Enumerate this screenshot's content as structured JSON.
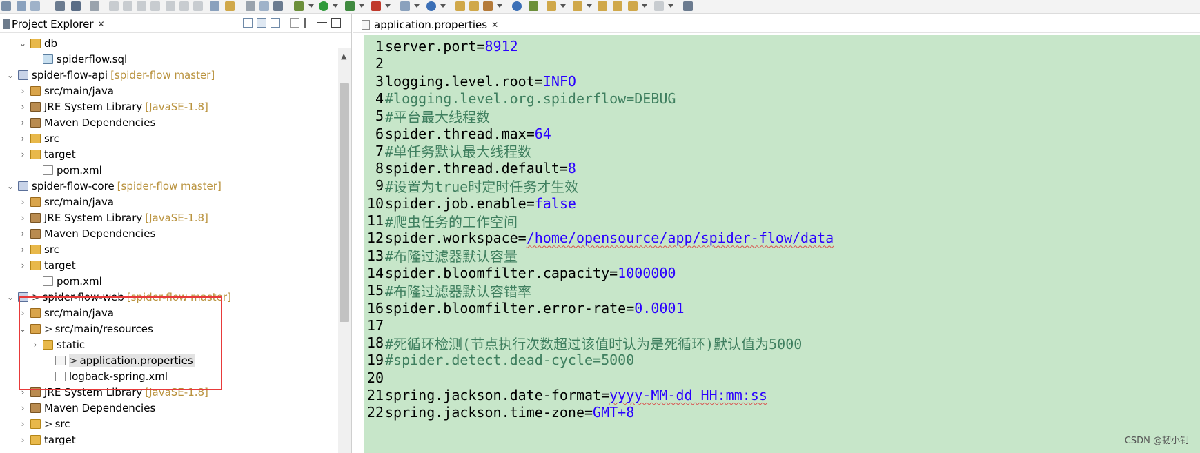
{
  "project_explorer": {
    "title": "Project Explorer",
    "close_icon": "close-icon",
    "tree": [
      {
        "label": "db",
        "indent": 1,
        "expanded": true,
        "icon": "folder-icon"
      },
      {
        "label": "spiderflow.sql",
        "indent": 2,
        "icon": "sql-file-icon"
      },
      {
        "label": "spider-flow-api",
        "deco": "[spider-flow master]",
        "indent": 0,
        "expanded": true,
        "icon": "maven-project-icon"
      },
      {
        "label": "src/main/java",
        "indent": 1,
        "collapsed": true,
        "icon": "source-folder-icon"
      },
      {
        "label": "JRE System Library",
        "deco": "[JavaSE-1.8]",
        "indent": 1,
        "collapsed": true,
        "icon": "library-icon"
      },
      {
        "label": "Maven Dependencies",
        "indent": 1,
        "collapsed": true,
        "icon": "library-icon"
      },
      {
        "label": "src",
        "indent": 1,
        "collapsed": true,
        "icon": "folder-icon"
      },
      {
        "label": "target",
        "indent": 1,
        "collapsed": true,
        "icon": "folder-icon"
      },
      {
        "label": "pom.xml",
        "indent": 2,
        "icon": "xml-file-icon"
      },
      {
        "label": "spider-flow-core",
        "deco": "[spider-flow master]",
        "indent": 0,
        "expanded": true,
        "icon": "maven-project-icon"
      },
      {
        "label": "src/main/java",
        "indent": 1,
        "collapsed": true,
        "icon": "source-folder-icon"
      },
      {
        "label": "JRE System Library",
        "deco": "[JavaSE-1.8]",
        "indent": 1,
        "collapsed": true,
        "icon": "library-icon"
      },
      {
        "label": "Maven Dependencies",
        "indent": 1,
        "collapsed": true,
        "icon": "library-icon"
      },
      {
        "label": "src",
        "indent": 1,
        "collapsed": true,
        "icon": "folder-icon"
      },
      {
        "label": "target",
        "indent": 1,
        "collapsed": true,
        "icon": "folder-icon"
      },
      {
        "label": "pom.xml",
        "indent": 2,
        "icon": "xml-file-icon"
      },
      {
        "label": "spider-flow-web",
        "deco": "[spider-flow master]",
        "dirty": ">",
        "indent": 0,
        "expanded": true,
        "icon": "maven-project-icon"
      },
      {
        "label": "src/main/java",
        "indent": 1,
        "collapsed": true,
        "icon": "source-folder-icon"
      },
      {
        "label": "src/main/resources",
        "dirty": ">",
        "indent": 1,
        "expanded": true,
        "icon": "source-folder-icon"
      },
      {
        "label": "static",
        "indent": 2,
        "collapsed": true,
        "icon": "folder-icon"
      },
      {
        "label": "application.properties",
        "dirty": ">",
        "indent": 3,
        "selected": true,
        "icon": "properties-file-icon"
      },
      {
        "label": "logback-spring.xml",
        "indent": 3,
        "icon": "xml-file-icon"
      },
      {
        "label": "JRE System Library",
        "deco": "[JavaSE-1.8]",
        "indent": 1,
        "collapsed": true,
        "icon": "library-icon"
      },
      {
        "label": "Maven Dependencies",
        "indent": 1,
        "collapsed": true,
        "icon": "library-icon"
      },
      {
        "label": "src",
        "dirty": ">",
        "indent": 1,
        "collapsed": true,
        "icon": "folder-icon"
      },
      {
        "label": "target",
        "indent": 1,
        "collapsed": true,
        "icon": "folder-icon"
      }
    ]
  },
  "editor": {
    "tab_title": "application.properties",
    "lines": [
      {
        "n": "1",
        "key": "server.port=",
        "val": "8912",
        "cm": ""
      },
      {
        "n": "2",
        "key": "",
        "val": "",
        "cm": ""
      },
      {
        "n": "3",
        "key": "logging.level.root=",
        "val": "INFO",
        "cm": ""
      },
      {
        "n": "4",
        "key": "",
        "val": "",
        "cm": "#logging.level.org.spiderflow=DEBUG"
      },
      {
        "n": "5",
        "key": "",
        "val": "",
        "cm": "#平台最大线程数"
      },
      {
        "n": "6",
        "key": "spider.thread.max=",
        "val": "64",
        "cm": ""
      },
      {
        "n": "7",
        "key": "",
        "val": "",
        "cm": "#单任务默认最大线程数"
      },
      {
        "n": "8",
        "key": "spider.thread.default=",
        "val": "8",
        "cm": ""
      },
      {
        "n": "9",
        "key": "",
        "val": "",
        "cm": "#设置为true时定时任务才生效"
      },
      {
        "n": "10",
        "key": "spider.job.enable=",
        "val": "false",
        "cm": ""
      },
      {
        "n": "11",
        "key": "",
        "val": "",
        "cm": "#爬虫任务的工作空间"
      },
      {
        "n": "12",
        "key": "spider.workspace=",
        "val": "/home/opensource/app/spider-flow/data",
        "cm": ""
      },
      {
        "n": "13",
        "key": "",
        "val": "",
        "cm": "#布隆过滤器默认容量"
      },
      {
        "n": "14",
        "key": "spider.bloomfilter.capacity=",
        "val": "1000000",
        "cm": ""
      },
      {
        "n": "15",
        "key": "",
        "val": "",
        "cm": "#布隆过滤器默认容错率"
      },
      {
        "n": "16",
        "key": "spider.bloomfilter.error-rate=",
        "val": "0.0001",
        "cm": ""
      },
      {
        "n": "17",
        "key": "",
        "val": "",
        "cm": ""
      },
      {
        "n": "18",
        "key": "",
        "val": "",
        "cm": "#死循环检测(节点执行次数超过该值时认为是死循环)默认值为5000"
      },
      {
        "n": "19",
        "key": "",
        "val": "",
        "cm": "#spider.detect.dead-cycle=5000"
      },
      {
        "n": "20",
        "key": "",
        "val": "",
        "cm": ""
      },
      {
        "n": "21",
        "key": "spring.jackson.date-format=",
        "val": "yyyy-MM-dd HH:mm:ss",
        "cm": ""
      },
      {
        "n": "22",
        "key": "spring.jackson.time-zone=",
        "val": "GMT+8",
        "cm": ""
      }
    ]
  },
  "watermark": "CSDN @韧小钊",
  "colors": {
    "editor_bg": "#c7e6c9",
    "value": "#2a00ff",
    "comment": "#3f7f5f",
    "highlight_box": "#e83a3a",
    "decoration": "#b9923d"
  }
}
